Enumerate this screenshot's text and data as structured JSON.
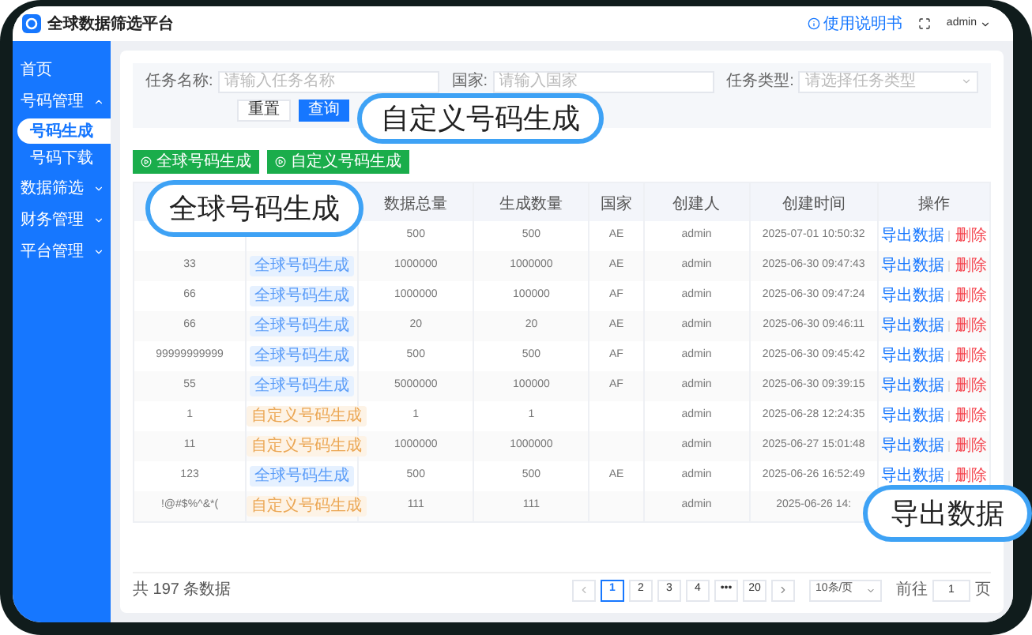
{
  "header": {
    "title": "全球数据筛选平台",
    "help": "使用说明书",
    "user": "admin"
  },
  "sidebar": {
    "items": [
      {
        "label": "首页",
        "kind": "link"
      },
      {
        "label": "号码管理",
        "kind": "group",
        "expanded": true,
        "children": [
          {
            "label": "号码生成",
            "selected": true
          },
          {
            "label": "号码下载",
            "selected": false
          }
        ]
      },
      {
        "label": "数据筛选",
        "kind": "group",
        "expanded": false
      },
      {
        "label": "财务管理",
        "kind": "group",
        "expanded": false
      },
      {
        "label": "平台管理",
        "kind": "group",
        "expanded": false
      }
    ]
  },
  "search": {
    "fields": [
      {
        "label": "任务名称:",
        "placeholder": "请输入任务名称",
        "kind": "input"
      },
      {
        "label": "国家:",
        "placeholder": "请输入国家",
        "kind": "input"
      },
      {
        "label": "任务类型:",
        "placeholder": "请选择任务类型",
        "kind": "select"
      }
    ],
    "buttons": [
      {
        "label": "重置",
        "kind": "plain"
      },
      {
        "label": "查询",
        "kind": "primary"
      }
    ]
  },
  "actions": [
    "全球号码生成",
    "自定义号码生成"
  ],
  "table": {
    "columns": [
      "数据总量",
      "生成数量",
      "国家",
      "创建人",
      "创建时间",
      "操作"
    ],
    "rows": [
      {
        "total": "500",
        "generated": "500",
        "country": "AE",
        "creator": "admin",
        "time": "2025-07-01 10:50:32",
        "ops": [
          "导出数据",
          "删除"
        ]
      },
      {
        "name": "33",
        "tag": {
          "label": "全球号码生成",
          "kind": "global"
        },
        "total": "1000000",
        "generated": "1000000",
        "country": "AE",
        "creator": "admin",
        "time": "2025-06-30 09:47:43",
        "ops": [
          "导出数据",
          "删除"
        ]
      },
      {
        "name": "66",
        "tag": {
          "label": "全球号码生成",
          "kind": "global"
        },
        "total": "1000000",
        "generated": "100000",
        "country": "AF",
        "creator": "admin",
        "time": "2025-06-30 09:47:24",
        "ops": [
          "导出数据",
          "删除"
        ]
      },
      {
        "name": "66",
        "tag": {
          "label": "全球号码生成",
          "kind": "global"
        },
        "total": "20",
        "generated": "20",
        "country": "AE",
        "creator": "admin",
        "time": "2025-06-30 09:46:11",
        "ops": [
          "导出数据",
          "删除"
        ]
      },
      {
        "name": "99999999999",
        "tag": {
          "label": "全球号码生成",
          "kind": "global"
        },
        "total": "500",
        "generated": "500",
        "country": "AF",
        "creator": "admin",
        "time": "2025-06-30 09:45:42",
        "ops": [
          "导出数据",
          "删除"
        ]
      },
      {
        "name": "55",
        "tag": {
          "label": "全球号码生成",
          "kind": "global"
        },
        "total": "5000000",
        "generated": "100000",
        "country": "AF",
        "creator": "admin",
        "time": "2025-06-30 09:39:15",
        "ops": [
          "导出数据",
          "删除"
        ]
      },
      {
        "name": "1",
        "tag": {
          "label": "自定义号码生成",
          "kind": "custom"
        },
        "total": "1",
        "generated": "1",
        "creator": "admin",
        "time": "2025-06-28 12:24:35",
        "ops": [
          "导出数据",
          "删除"
        ]
      },
      {
        "name": "11",
        "tag": {
          "label": "自定义号码生成",
          "kind": "custom"
        },
        "total": "1000000",
        "generated": "1000000",
        "creator": "admin",
        "time": "2025-06-27 15:01:48",
        "ops": [
          "导出数据",
          "删除"
        ]
      },
      {
        "name": "123",
        "tag": {
          "label": "全球号码生成",
          "kind": "global"
        },
        "total": "500",
        "generated": "500",
        "country": "AE",
        "creator": "admin",
        "time": "2025-06-26 16:52:49",
        "ops": [
          "导出数据",
          "删除"
        ]
      },
      {
        "name": "!@#$%^&*(",
        "tag": {
          "label": "自定义号码生成",
          "kind": "custom"
        },
        "total": "111",
        "generated": "111",
        "creator": "admin",
        "time": "2025-06-26 14:"
      }
    ]
  },
  "pagination": {
    "total": "共 197 条数据",
    "pages": [
      {
        "label": "1",
        "selected": true
      },
      {
        "label": "2",
        "selected": false
      },
      {
        "label": "3",
        "selected": false
      },
      {
        "label": "4",
        "selected": false
      },
      {
        "label": "•••",
        "selected": false
      },
      {
        "label": "20",
        "selected": false
      }
    ],
    "page_size": "10条/页",
    "goto_label": "前往",
    "goto_value": "1",
    "goto_unit": "页"
  },
  "callouts": [
    "自定义号码生成",
    "全球号码生成",
    "导出数据"
  ]
}
